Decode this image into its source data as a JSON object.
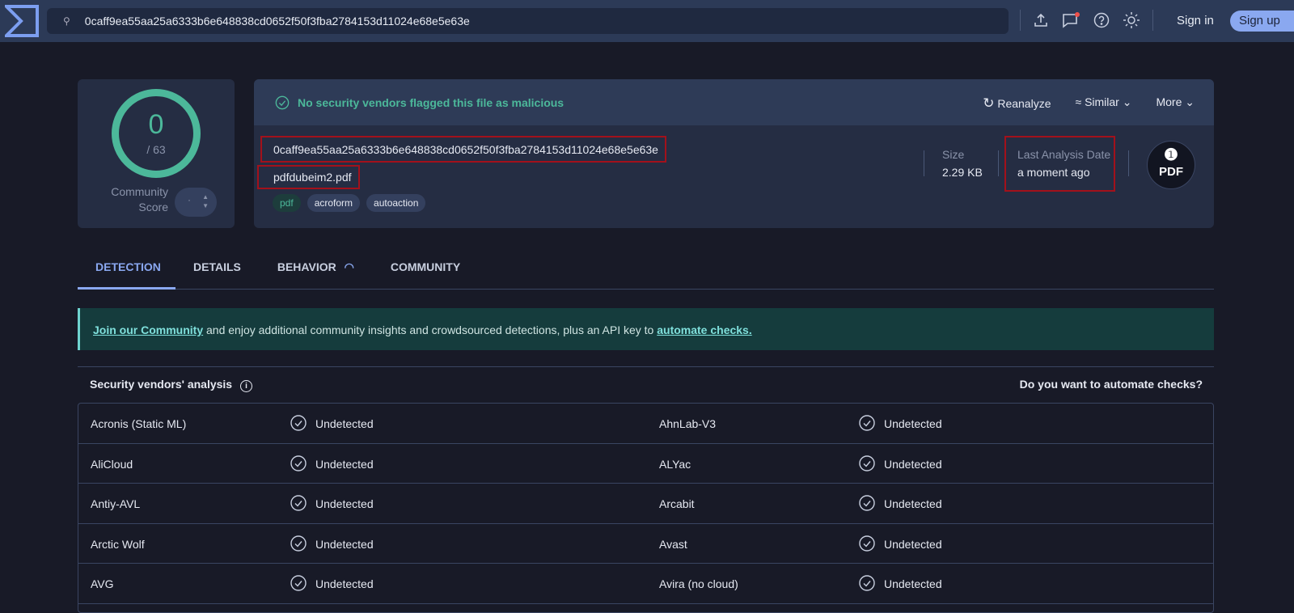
{
  "topbar": {
    "search_value": "0caff9ea55aa25a6333b6e648838cd0652f50f3fba2784153d11024e68e5e63e",
    "sign_in": "Sign in",
    "sign_up": "Sign up"
  },
  "score": {
    "detections": "0",
    "total": "/ 63",
    "community_label_1": "Community",
    "community_label_2": "Score",
    "community_value": "·"
  },
  "summary": {
    "status": "No security vendors flagged this file as malicious",
    "reanalyze": "Reanalyze",
    "similar": "Similar",
    "more": "More",
    "hash": "0caff9ea55aa25a6333b6e648838cd0652f50f3fba2784153d11024e68e5e63e",
    "filename": "pdfdubeim2.pdf",
    "tags": [
      "pdf",
      "acroform",
      "autoaction"
    ],
    "size_label": "Size",
    "size_value": "2.29 KB",
    "date_label": "Last Analysis Date",
    "date_value": "a moment ago",
    "file_type": "PDF"
  },
  "tabs": [
    "DETECTION",
    "DETAILS",
    "BEHAVIOR",
    "COMMUNITY"
  ],
  "banner": {
    "link1": "Join our Community",
    "middle": " and enjoy additional community insights and crowdsourced detections, plus an API key to ",
    "link2": "automate checks."
  },
  "vendors_section": {
    "title": "Security vendors' analysis",
    "cta": "Do you want to automate checks?"
  },
  "vendors": [
    {
      "left": "Acronis (Static ML)",
      "left_status": "Undetected",
      "right": "AhnLab-V3",
      "right_status": "Undetected"
    },
    {
      "left": "AliCloud",
      "left_status": "Undetected",
      "right": "ALYac",
      "right_status": "Undetected"
    },
    {
      "left": "Antiy-AVL",
      "left_status": "Undetected",
      "right": "Arcabit",
      "right_status": "Undetected"
    },
    {
      "left": "Arctic Wolf",
      "left_status": "Undetected",
      "right": "Avast",
      "right_status": "Undetected"
    },
    {
      "left": "AVG",
      "left_status": "Undetected",
      "right": "Avira (no cloud)",
      "right_status": "Undetected"
    }
  ],
  "colors": {
    "accent": "#8aa8f0",
    "clean": "#4cb89a",
    "highlight_box": "#a3111b"
  }
}
